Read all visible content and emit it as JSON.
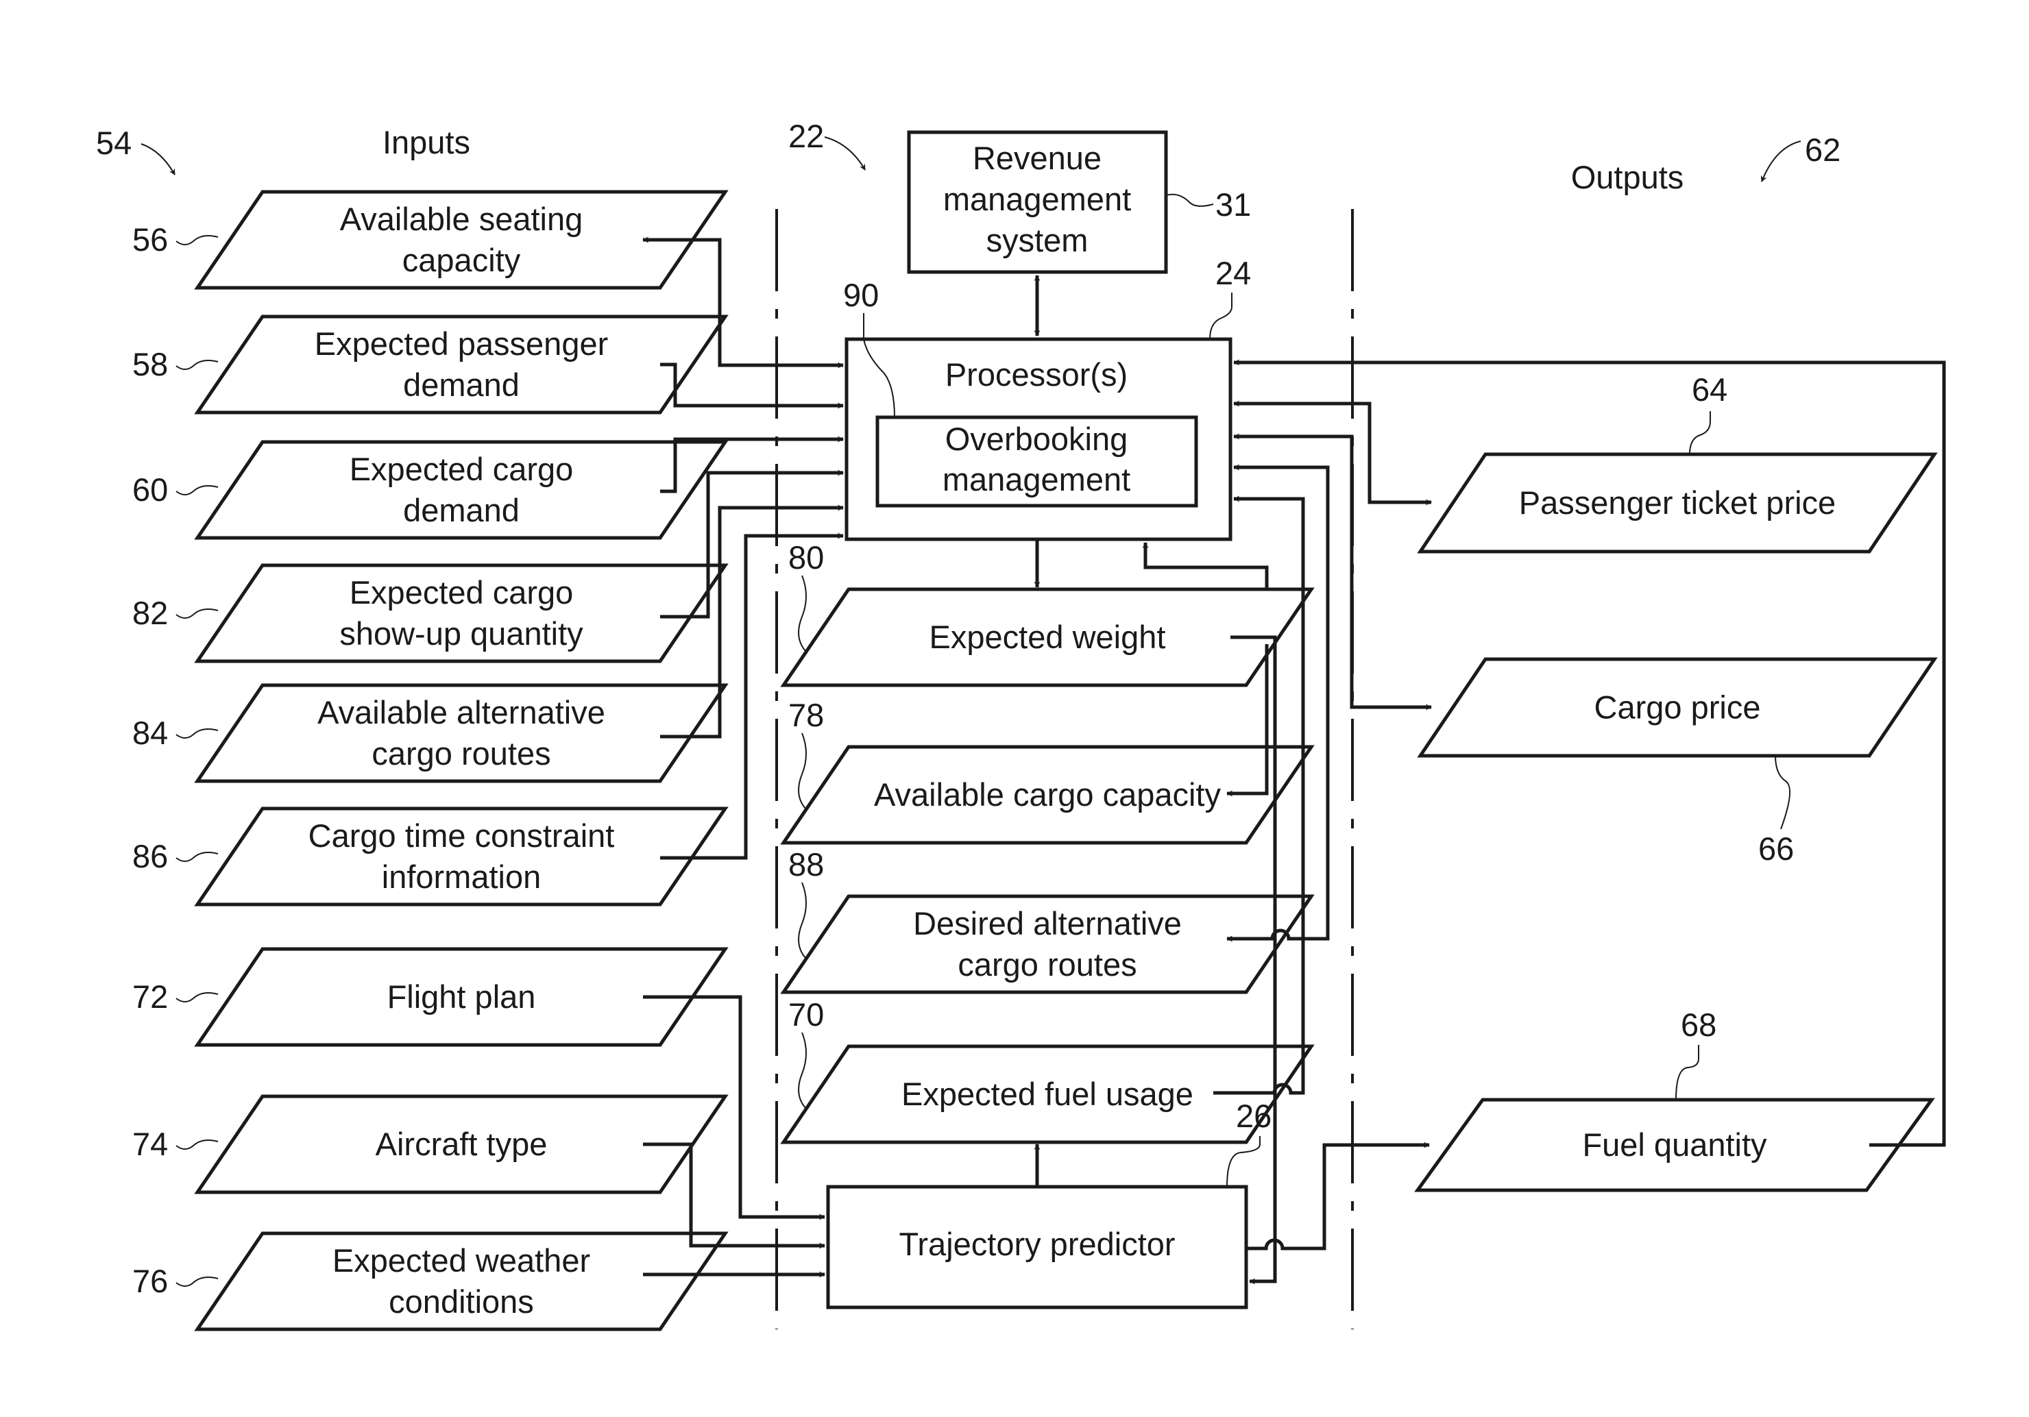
{
  "figure": {
    "sections": {
      "inputs": {
        "heading": "Inputs",
        "ref": "54"
      },
      "system": {
        "ref": "22"
      },
      "outputs": {
        "heading": "Outputs",
        "ref": "62"
      }
    },
    "inputs": [
      {
        "ref": "56",
        "lines": [
          "Available seating",
          "capacity"
        ]
      },
      {
        "ref": "58",
        "lines": [
          "Expected passenger",
          "demand"
        ]
      },
      {
        "ref": "60",
        "lines": [
          "Expected cargo",
          "demand"
        ]
      },
      {
        "ref": "82",
        "lines": [
          "Expected cargo",
          "show-up quantity"
        ]
      },
      {
        "ref": "84",
        "lines": [
          "Available alternative",
          "cargo routes"
        ]
      },
      {
        "ref": "86",
        "lines": [
          "Cargo time constraint",
          "information"
        ]
      },
      {
        "ref": "72",
        "lines": [
          "Flight plan"
        ]
      },
      {
        "ref": "74",
        "lines": [
          "Aircraft type"
        ]
      },
      {
        "ref": "76",
        "lines": [
          "Expected weather",
          "conditions"
        ]
      }
    ],
    "revenue_system": {
      "ref": "31",
      "lines": [
        "Revenue",
        "management",
        "system"
      ]
    },
    "processor": {
      "ref": "24",
      "label": "Processor(s)"
    },
    "overbooking": {
      "ref": "90",
      "lines": [
        "Overbooking",
        "management"
      ]
    },
    "intermediates": [
      {
        "ref": "80",
        "lines": [
          "Expected weight"
        ]
      },
      {
        "ref": "78",
        "lines": [
          "Available cargo capacity"
        ]
      },
      {
        "ref": "88",
        "lines": [
          "Desired alternative",
          "cargo routes"
        ]
      },
      {
        "ref": "70",
        "lines": [
          "Expected fuel usage"
        ]
      }
    ],
    "trajectory_predictor": {
      "ref": "26",
      "label": "Trajectory predictor"
    },
    "outputs": [
      {
        "ref": "64",
        "lines": [
          "Passenger ticket price"
        ]
      },
      {
        "ref": "66",
        "lines": [
          "Cargo price"
        ]
      },
      {
        "ref": "68",
        "lines": [
          "Fuel quantity"
        ]
      }
    ]
  }
}
